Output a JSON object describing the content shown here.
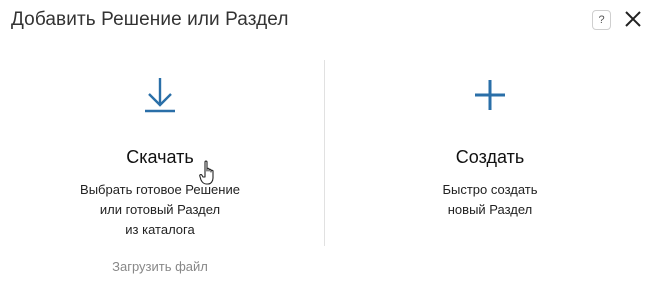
{
  "dialog": {
    "title": "Добавить Решение или Раздел",
    "help_label": "?",
    "close_icon": "close-icon"
  },
  "options": [
    {
      "id": "download",
      "icon": "download-icon",
      "label": "Скачать",
      "description": "Выбрать готовое Решение\nили готовый Раздел\nиз каталога"
    },
    {
      "id": "create",
      "icon": "plus-icon",
      "label": "Создать",
      "description": "Быстро создать\nновый Раздел"
    }
  ],
  "upload": {
    "label": "Загрузить файл"
  },
  "colors": {
    "accent": "#2a6fa8",
    "text": "#222222",
    "muted": "#888888",
    "divider": "#e1e1e1"
  }
}
